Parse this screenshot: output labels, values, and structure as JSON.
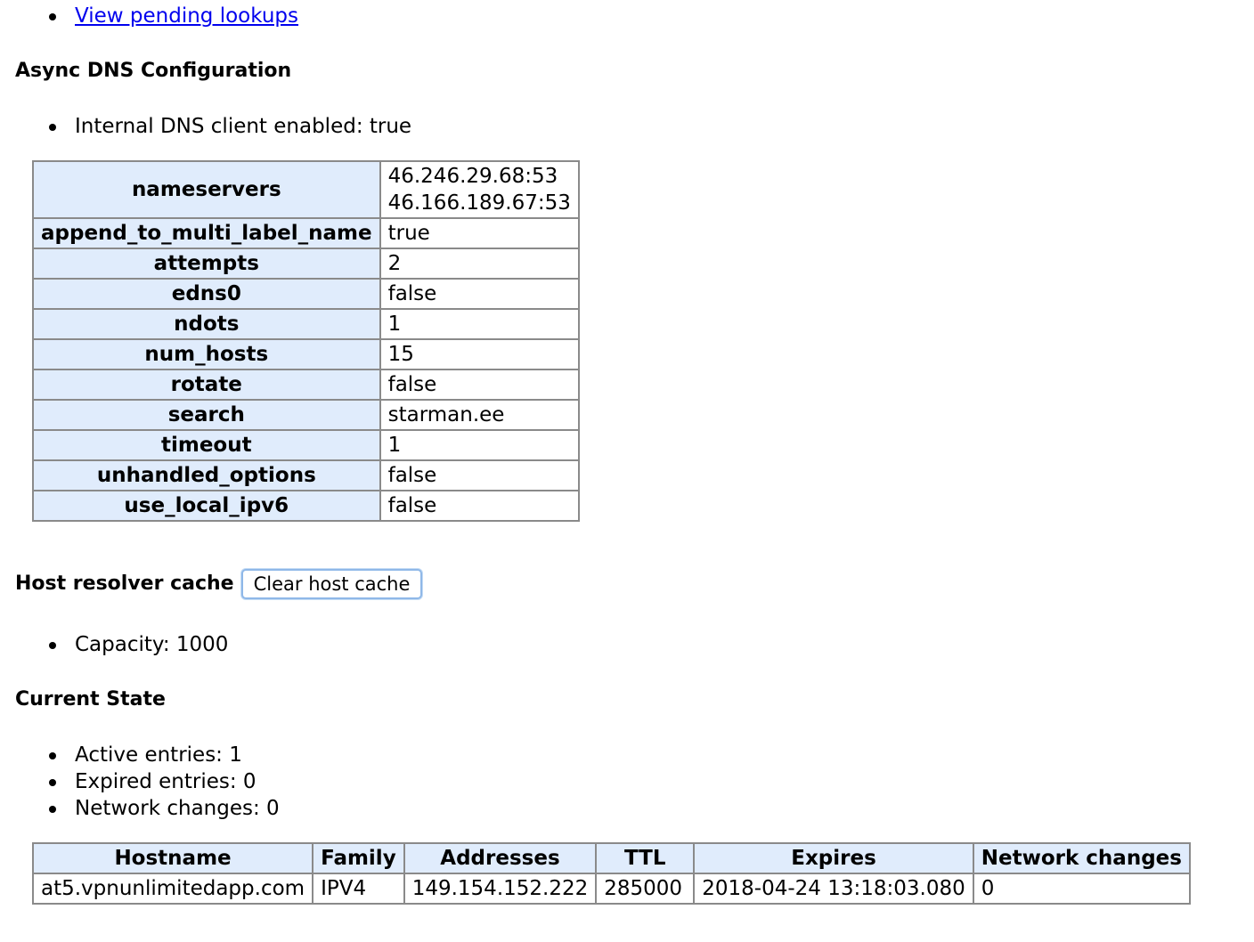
{
  "top_links": {
    "pending_lookups": "View pending lookups"
  },
  "async_dns": {
    "heading": "Async DNS Configuration",
    "internal_client": "Internal DNS client enabled: true",
    "config": {
      "nameservers_label": "nameservers",
      "nameservers": [
        "46.246.29.68:53",
        "46.166.189.67:53"
      ],
      "rows": [
        {
          "key": "append_to_multi_label_name",
          "value": "true"
        },
        {
          "key": "attempts",
          "value": "2"
        },
        {
          "key": "edns0",
          "value": "false"
        },
        {
          "key": "ndots",
          "value": "1"
        },
        {
          "key": "num_hosts",
          "value": "15"
        },
        {
          "key": "rotate",
          "value": "false"
        },
        {
          "key": "search",
          "value": "starman.ee"
        },
        {
          "key": "timeout",
          "value": "1"
        },
        {
          "key": "unhandled_options",
          "value": "false"
        },
        {
          "key": "use_local_ipv6",
          "value": "false"
        }
      ]
    }
  },
  "host_cache": {
    "heading": "Host resolver cache",
    "clear_button": "Clear host cache",
    "capacity": "Capacity: 1000"
  },
  "current_state": {
    "heading": "Current State",
    "stats": [
      "Active entries: 1",
      "Expired entries: 0",
      "Network changes: 0"
    ],
    "columns": [
      "Hostname",
      "Family",
      "Addresses",
      "TTL",
      "Expires",
      "Network changes"
    ],
    "entries": [
      [
        "at5.vpnunlimitedapp.com",
        "IPV4",
        "149.154.152.222",
        "285000",
        "2018-04-24 13:18:03.080",
        "0"
      ]
    ]
  }
}
